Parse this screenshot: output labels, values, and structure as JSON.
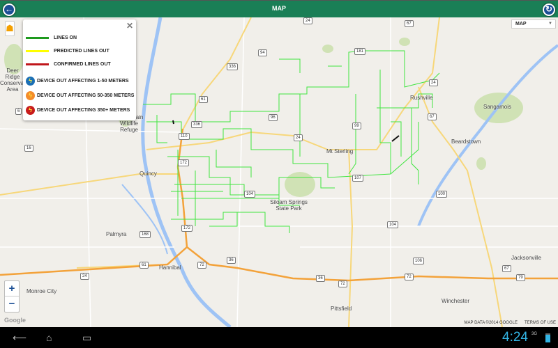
{
  "header": {
    "title": "MAP",
    "back_icon": "back-arrow-icon",
    "refresh_icon": "refresh-icon"
  },
  "legend": {
    "close": "✕",
    "lines": [
      {
        "label": "LINES ON",
        "color": "#1e9a1e"
      },
      {
        "label": "PREDICTED LINES OUT",
        "color": "#ffff00"
      },
      {
        "label": "CONFIRMED LINES OUT",
        "color": "#c0161b"
      }
    ],
    "devices": [
      {
        "label": "DEVICE OUT AFFECTING 1-50 METERS",
        "color": "#1b6fb5"
      },
      {
        "label": "DEVICE OUT AFFECTING 50-350 METERS",
        "color": "#f48c2a"
      },
      {
        "label": "DEVICE OUT AFFECTING 350+ METERS",
        "color": "#c81c1c"
      }
    ]
  },
  "map": {
    "map_type": "MAP",
    "zoom_in": "+",
    "zoom_out": "−",
    "logo": "Google",
    "attribution": "MAP DATA ©2014 GOOGLE",
    "terms": "TERMS OF USE",
    "places": [
      "Deer Ridge Conservation Area",
      "Mark Twain Wildlife Refuge",
      "Quincy",
      "Palmyra",
      "Hannibal",
      "Monroe City",
      "Mt Sterling",
      "Rushville",
      "Beardstown",
      "Sangamois",
      "Siloam Springs State Park",
      "Pittsfield",
      "Winchester",
      "Jacksonville"
    ],
    "shields": [
      "94",
      "336",
      "61",
      "110",
      "336",
      "96",
      "24",
      "99",
      "107",
      "104",
      "172",
      "172",
      "36",
      "72",
      "24",
      "67",
      "181",
      "67",
      "100",
      "104",
      "36",
      "72",
      "72",
      "67",
      "106",
      "6",
      "61",
      "16",
      "168",
      "24",
      "79",
      "24"
    ]
  },
  "statusbar": {
    "time": "4:24",
    "network": "3G"
  }
}
